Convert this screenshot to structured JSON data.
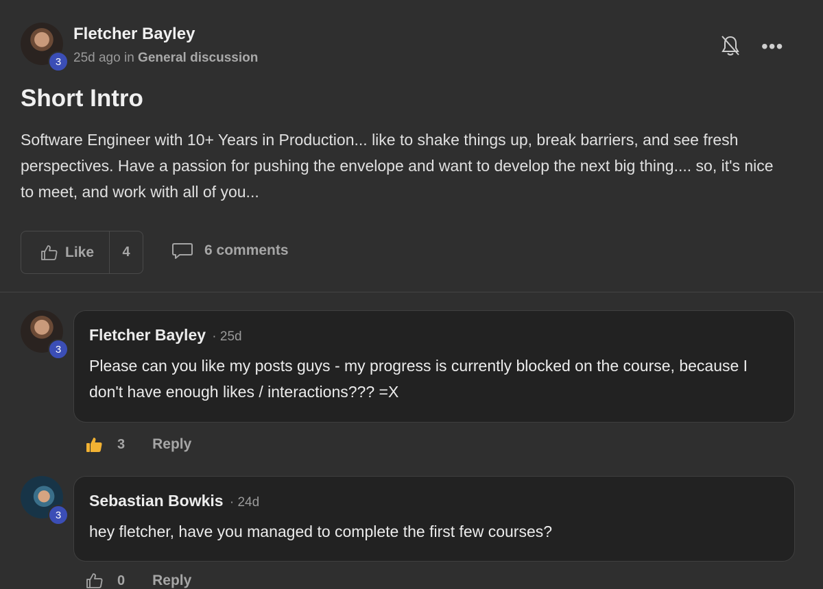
{
  "post": {
    "author": "Fletcher Bayley",
    "level": "3",
    "time": "25d ago",
    "in_word": "in",
    "category": "General discussion",
    "title": "Short Intro",
    "body": "Software Engineer with 10+ Years in Production... like to shake things up, break barriers, and see fresh perspectives. Have a passion for pushing the envelope and want to develop the next big thing.... so, it's nice to meet, and work with all of you...",
    "like_label": "Like",
    "like_count": "4",
    "comments_label": "6 comments",
    "icons": {
      "bell": "bell-off-icon",
      "more": "more-horizontal-icon",
      "like": "thumbs-up-outline-icon",
      "comment": "comment-bubble-icon"
    }
  },
  "comments": [
    {
      "author": "Fletcher Bayley",
      "level": "3",
      "time": "25d",
      "text": "Please can you like my posts guys - my progress is currently blocked on the course, because I don't have enough likes / interactions??? =X",
      "like_count": "3",
      "liked": true,
      "reply_label": "Reply"
    },
    {
      "author": "Sebastian Bowkis",
      "level": "3",
      "time": "24d",
      "text": "hey fletcher, have you managed to complete the first few courses?",
      "like_count": "0",
      "liked": false,
      "reply_label": "Reply"
    }
  ],
  "colors": {
    "background": "#2f2f2f",
    "bubble": "#222222",
    "badge": "#3b4eb6",
    "liked_thumb": "#f2b233"
  }
}
